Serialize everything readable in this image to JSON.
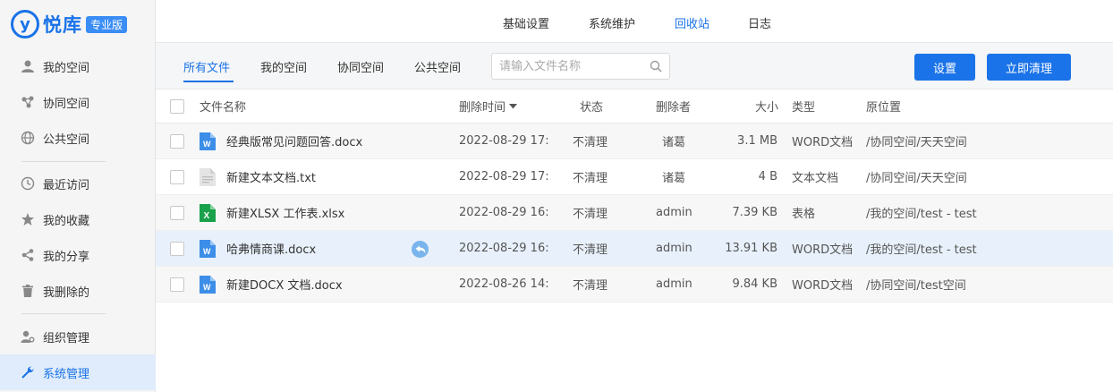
{
  "brand": {
    "mark": "y",
    "name": "悦库",
    "edition": "专业版"
  },
  "sidebar": {
    "items": [
      {
        "label": "我的空间"
      },
      {
        "label": "协同空间"
      },
      {
        "label": "公共空间"
      },
      {
        "label": "最近访问"
      },
      {
        "label": "我的收藏"
      },
      {
        "label": "我的分享"
      },
      {
        "label": "我删除的"
      },
      {
        "label": "组织管理"
      },
      {
        "label": "系统管理"
      }
    ],
    "active": "系统管理"
  },
  "topnav": {
    "items": [
      {
        "label": "基础设置"
      },
      {
        "label": "系统维护"
      },
      {
        "label": "回收站"
      },
      {
        "label": "日志"
      }
    ],
    "active": "回收站"
  },
  "tabs": {
    "items": [
      {
        "label": "所有文件"
      },
      {
        "label": "我的空间"
      },
      {
        "label": "协同空间"
      },
      {
        "label": "公共空间"
      }
    ],
    "active": "所有文件"
  },
  "search": {
    "placeholder": "请输入文件名称"
  },
  "buttons": {
    "settings": "设置",
    "clear_now": "立即清理"
  },
  "table": {
    "headers": {
      "name": "文件名称",
      "deleted_time": "删除时间",
      "status": "状态",
      "deleter": "删除者",
      "size": "大小",
      "type": "类型",
      "location": "原位置"
    },
    "rows": [
      {
        "name": "经典版常见问题回答.docx",
        "icon": "word-icon",
        "time": "2022-08-29 17:",
        "status": "不清理",
        "deleter": "诸葛",
        "size": "3.1 MB",
        "type": "WORD文档",
        "location": "/协同空间/天天空间"
      },
      {
        "name": "新建文本文档.txt",
        "icon": "text-file-icon",
        "time": "2022-08-29 17:",
        "status": "不清理",
        "deleter": "诸葛",
        "size": "4 B",
        "type": "文本文档",
        "location": "/协同空间/天天空间"
      },
      {
        "name": "新建XLSX 工作表.xlsx",
        "icon": "excel-icon",
        "time": "2022-08-29 16:",
        "status": "不清理",
        "deleter": "admin",
        "size": "7.39 KB",
        "type": "表格",
        "location": "/我的空间/test - test"
      },
      {
        "name": "哈弗情商课.docx",
        "icon": "word-icon",
        "time": "2022-08-29 16:",
        "status": "不清理",
        "deleter": "admin",
        "size": "13.91 KB",
        "type": "WORD文档",
        "location": "/我的空间/test - test"
      },
      {
        "name": "新建DOCX 文档.docx",
        "icon": "word-icon",
        "time": "2022-08-26 14:",
        "status": "不清理",
        "deleter": "admin",
        "size": "9.84 KB",
        "type": "WORD文档",
        "location": "/协同空间/test空间"
      }
    ]
  },
  "colors": {
    "accent": "#1a73e8",
    "sidebar_bg": "#f5f5f5",
    "row_hover": "#e8f1fb"
  }
}
